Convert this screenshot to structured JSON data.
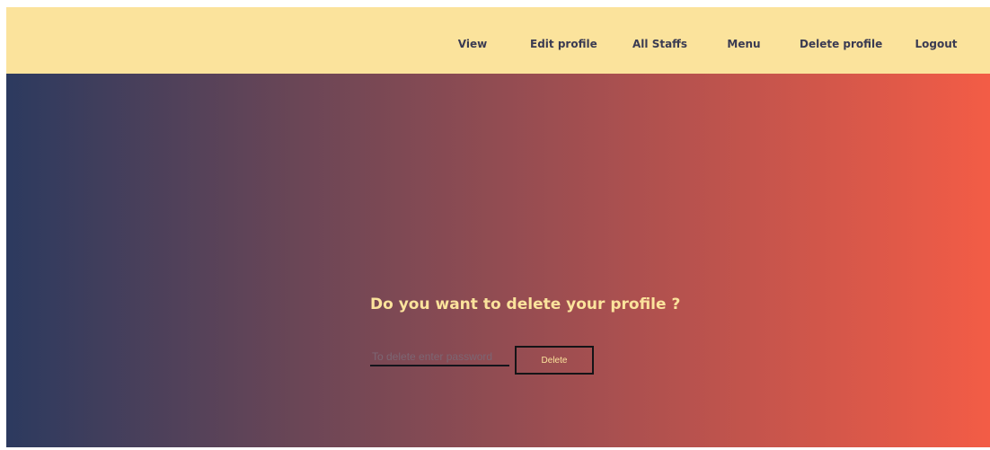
{
  "nav": {
    "items": [
      {
        "label": "View"
      },
      {
        "label": "Edit profile"
      },
      {
        "label": "All Staffs"
      },
      {
        "label": "Menu"
      },
      {
        "label": "Delete profile"
      },
      {
        "label": "Logout"
      }
    ]
  },
  "main": {
    "question": "Do you want to delete your profile ?",
    "password_placeholder": "To delete enter password",
    "password_value": "",
    "delete_label": "Delete"
  },
  "colors": {
    "navbar_bg": "#fbe39c",
    "nav_text": "#3a3b52",
    "gradient_start": "#2c3a5f",
    "gradient_end": "#f35c46",
    "accent_text": "#fbe39c"
  }
}
